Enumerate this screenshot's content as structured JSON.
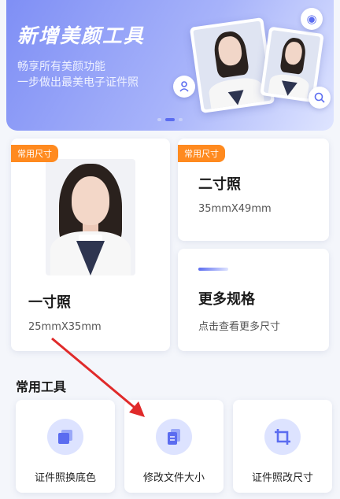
{
  "banner": {
    "title": "新增美颜工具",
    "subtitle_line1": "畅享所有美颜功能",
    "subtitle_line2": "一步做出最美电子证件照"
  },
  "carousel": {
    "current_page": 2,
    "total_pages": 3
  },
  "cards": {
    "one_inch": {
      "tag": "常用尺寸",
      "title": "一寸照",
      "size": "25mmX35mm"
    },
    "two_inch": {
      "tag": "常用尺寸",
      "title": "二寸照",
      "size": "35mmX49mm"
    },
    "more": {
      "title": "更多规格",
      "subtitle": "点击查看更多尺寸"
    }
  },
  "tools": {
    "section_title": "常用工具",
    "items": [
      {
        "label": "证件照换底色",
        "icon": "layers-icon"
      },
      {
        "label": "修改文件大小",
        "icon": "document-icon"
      },
      {
        "label": "证件照改尺寸",
        "icon": "crop-icon"
      }
    ]
  },
  "colors": {
    "accent": "#5b6cf0",
    "tag": "#ff8a1f",
    "arrow": "#e02a2a"
  }
}
